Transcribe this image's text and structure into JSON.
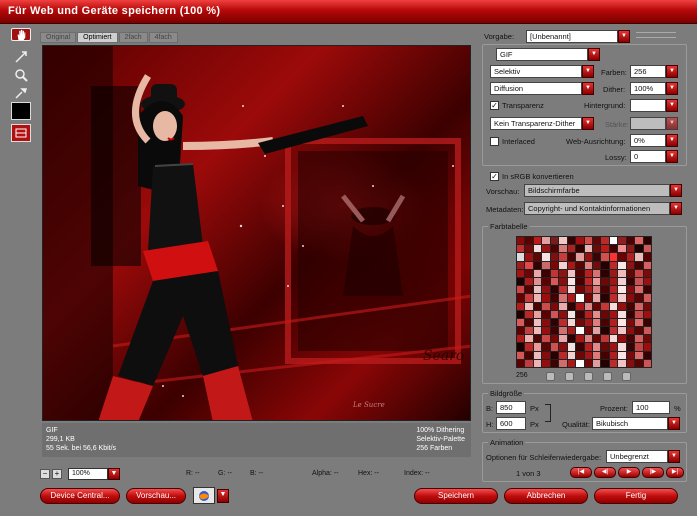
{
  "window": {
    "title": "Für Web und Geräte speichern (100 %)"
  },
  "tabs": [
    {
      "label": "Original"
    },
    {
      "label": "Optimiert"
    },
    {
      "label": "2fach"
    },
    {
      "label": "4fach"
    }
  ],
  "tools": [
    "hand-icon",
    "slice-select-icon",
    "zoom-icon",
    "eyedropper-icon",
    "eyedropper-color-icon",
    "toggle-slices-icon"
  ],
  "preview": {
    "watermark": "Searo",
    "stamp": "Le Sucre"
  },
  "info": {
    "format": "GIF",
    "size": "299,1 KB",
    "time": "55 Sek. bei 56,6 Kbit/s",
    "dither": "100% Dithering",
    "palette": "Selektiv-Palette",
    "colors": "256 Farben"
  },
  "zoom": {
    "minus": "−",
    "plus": "+",
    "value": "100%"
  },
  "readouts": {
    "r": "R: --",
    "g": "G: --",
    "b": "B: --",
    "alpha": "Alpha: --",
    "hex": "Hex: --",
    "index": "Index: --"
  },
  "buttons": {
    "device_central": "Device Central...",
    "preview": "Vorschau...",
    "save": "Speichern",
    "cancel": "Abbrechen",
    "done": "Fertig"
  },
  "settings": {
    "preset_label": "Vorgabe:",
    "preset_value": "[Unbenannt]",
    "format_value": "GIF",
    "reduction_value": "Selektiv",
    "colors_label": "Farben:",
    "colors_value": "256",
    "dither_algo_value": "Diffusion",
    "dither_label": "Dither:",
    "dither_value": "100%",
    "transparency_label": "Transparenz",
    "transparency_checked": true,
    "matte_label": "Hintergrund:",
    "trans_dither_value": "Kein Transparenz-Dither",
    "amount_label": "Stärke:",
    "interlaced_label": "Interlaced",
    "interlaced_checked": false,
    "web_snap_label": "Web-Ausrichtung:",
    "web_snap_value": "0%",
    "lossy_label": "Lossy:",
    "lossy_value": "0",
    "srgb_label": "In sRGB konvertieren",
    "srgb_checked": true,
    "preview_label": "Vorschau:",
    "preview_value": "Bildschirmfarbe",
    "metadata_label": "Metadaten:",
    "metadata_value": "Copyright- und Kontaktinformationen"
  },
  "color_table": {
    "title": "Farbtabelle",
    "count": "256",
    "colors": [
      "#8a0a0a",
      "#5c0000",
      "#c21818",
      "#e3a0a0",
      "#7a1c1c",
      "#f0c8c8",
      "#3a0000",
      "#a40e0e",
      "#d44a4a",
      "#620404",
      "#b92a2a",
      "#ffffff",
      "#8e2020",
      "#4c0202",
      "#e06666",
      "#2c0000",
      "#c03030",
      "#780808",
      "#f5dada",
      "#9a1414",
      "#510000",
      "#d87a7a",
      "#a82222",
      "#330000",
      "#e8b0b0",
      "#6c0a0a",
      "#bb1a1a",
      "#420000",
      "#f09090",
      "#8c1818",
      "#220000",
      "#cc5a5a",
      "#ddd",
      "#a01010",
      "#5e0606",
      "#f6e0e0",
      "#7e1010",
      "#c83c3c",
      "#4a0000",
      "#e19c9c",
      "#961010",
      "#3c0404",
      "#d05050",
      "#ff3030",
      "#6a0202",
      "#b51e1e",
      "#ecbcbc",
      "#580000",
      "#9e1c1c",
      "#e24848",
      "#360000",
      "#c86a6a",
      "#800606",
      "#f4d0d0",
      "#ae1616",
      "#5a0404",
      "#da8282",
      "#740c0c",
      "#280000",
      "#be2828",
      "#f8e8e8",
      "#921212",
      "#480000",
      "#d66060",
      "#a61212",
      "#6e0404",
      "#e8a8a8",
      "#3e0000",
      "#c43434",
      "#8a1414",
      "#f2c0c0",
      "#520202",
      "#b82020",
      "#dc7070",
      "#2e0000",
      "#9c1818",
      "#eebaba",
      "#640606",
      "#cc4444",
      "#7c0a0a",
      "#1a0000",
      "#b01a1a",
      "#e49090",
      "#5c0202",
      "#d65858",
      "#880e0e",
      "#fae4e4",
      "#440000",
      "#c02424",
      "#ea9898",
      "#6e0808",
      "#a21414",
      "#f0d0d0",
      "#3a0202",
      "#c85050",
      "#961212",
      "#d24444",
      "#540000",
      "#e8c0c0",
      "#8e1010",
      "#300000",
      "#bc3030",
      "#f6d8d8",
      "#720606",
      "#a41c1c",
      "#e07878",
      "#4e0000",
      "#b62222",
      "#fde8e8",
      "#820c0c",
      "#da6868",
      "#3c0000",
      "#640000",
      "#c83a3a",
      "#f0b4b4",
      "#9a0e0e",
      "#420202",
      "#d47474",
      "#ac1818",
      "#ffffff",
      "#760606",
      "#e6a4a4",
      "#2a0000",
      "#c02a2a",
      "#f4cccc",
      "#8c0c0c",
      "#580404",
      "#d05c5c",
      "#b41c1c",
      "#f2bcbc",
      "#4c0000",
      "#cc4c4c",
      "#7e0808",
      "#e8acac",
      "#340000",
      "#a81616",
      "#dc8888",
      "#680404",
      "#c63838",
      "#f8dcdc",
      "#940e0e",
      "#460000",
      "#d46262",
      "#720a0a",
      "#1e0000",
      "#be2626",
      "#ea9e9e",
      "#5e0000",
      "#d25454",
      "#8a1010",
      "#f6e4e4",
      "#3e0202",
      "#b62020",
      "#e48c8c",
      "#6c0606",
      "#a01414",
      "#fbdede",
      "#380000",
      "#c84646",
      "#9e1010",
      "#d85a5a",
      "#500000",
      "#eebebe",
      "#880c0c",
      "#2c0202",
      "#ba2c2c",
      "#f4d4d4",
      "#700808",
      "#a61818",
      "#e27c7c",
      "#4a0202",
      "#b41e1e",
      "#fee6e6",
      "#7c0c0c",
      "#dc6c6c",
      "#360202",
      "#600000",
      "#c43e3e",
      "#f0b8b8",
      "#980e0e",
      "#400000",
      "#d27070",
      "#aa1a1a",
      "#ffffff",
      "#740808",
      "#e4a0a0",
      "#260000",
      "#be2e2e",
      "#f2c8c8",
      "#8e0e0e",
      "#5a0202",
      "#ce5858",
      "#b21a1a",
      "#f0b0b0",
      "#4e0202",
      "#ca4848",
      "#7a0606",
      "#e6a8a8",
      "#320000",
      "#a61414",
      "#da8484",
      "#660404",
      "#c43434",
      "#f6d8d8",
      "#920c0c",
      "#440202",
      "#d25e5e",
      "#700808",
      "#1c0000",
      "#bc2424",
      "#e89a9a",
      "#5c0404",
      "#d05050",
      "#880e0e",
      "#f4e0e0",
      "#3c0000",
      "#b41e1e",
      "#e28888",
      "#6a0606",
      "#9e1212",
      "#f8dada",
      "#360202",
      "#c64242",
      "#9c0e0e",
      "#d65656",
      "#4e0000",
      "#ecbaba",
      "#860c0c",
      "#2a0000",
      "#b82a2a",
      "#f2d0d0",
      "#6e0606",
      "#a41616",
      "#e07878",
      "#480000",
      "#b21c1c",
      "#fce4e4",
      "#7a0a0a",
      "#da6868",
      "#340000",
      "#5e0000",
      "#c23a3a",
      "#eeb4b4",
      "#960c0c",
      "#3e0000",
      "#d06c6c",
      "#a81818",
      "#ffffff",
      "#720606",
      "#e29c9c",
      "#240000",
      "#bc2a2a",
      "#f0c4c4",
      "#8c0c0c",
      "#580202",
      "#cc5454"
    ]
  },
  "image_size": {
    "title": "Bildgröße",
    "w_label": "B:",
    "w_value": "850",
    "w_unit": "Px",
    "h_label": "H:",
    "h_value": "600",
    "h_unit": "Px",
    "percent_label": "Prozent:",
    "percent_value": "100",
    "percent_unit": "%",
    "quality_label": "Qualität:",
    "quality_value": "Bikubisch"
  },
  "animation": {
    "title": "Animation",
    "loop_label": "Optionen für Schleifenwiedergabe:",
    "loop_value": "Unbegrenzt",
    "frame_counter": "1 von 3",
    "controls": [
      "first-frame-icon",
      "prev-frame-icon",
      "play-icon",
      "next-frame-icon",
      "last-frame-icon"
    ]
  }
}
